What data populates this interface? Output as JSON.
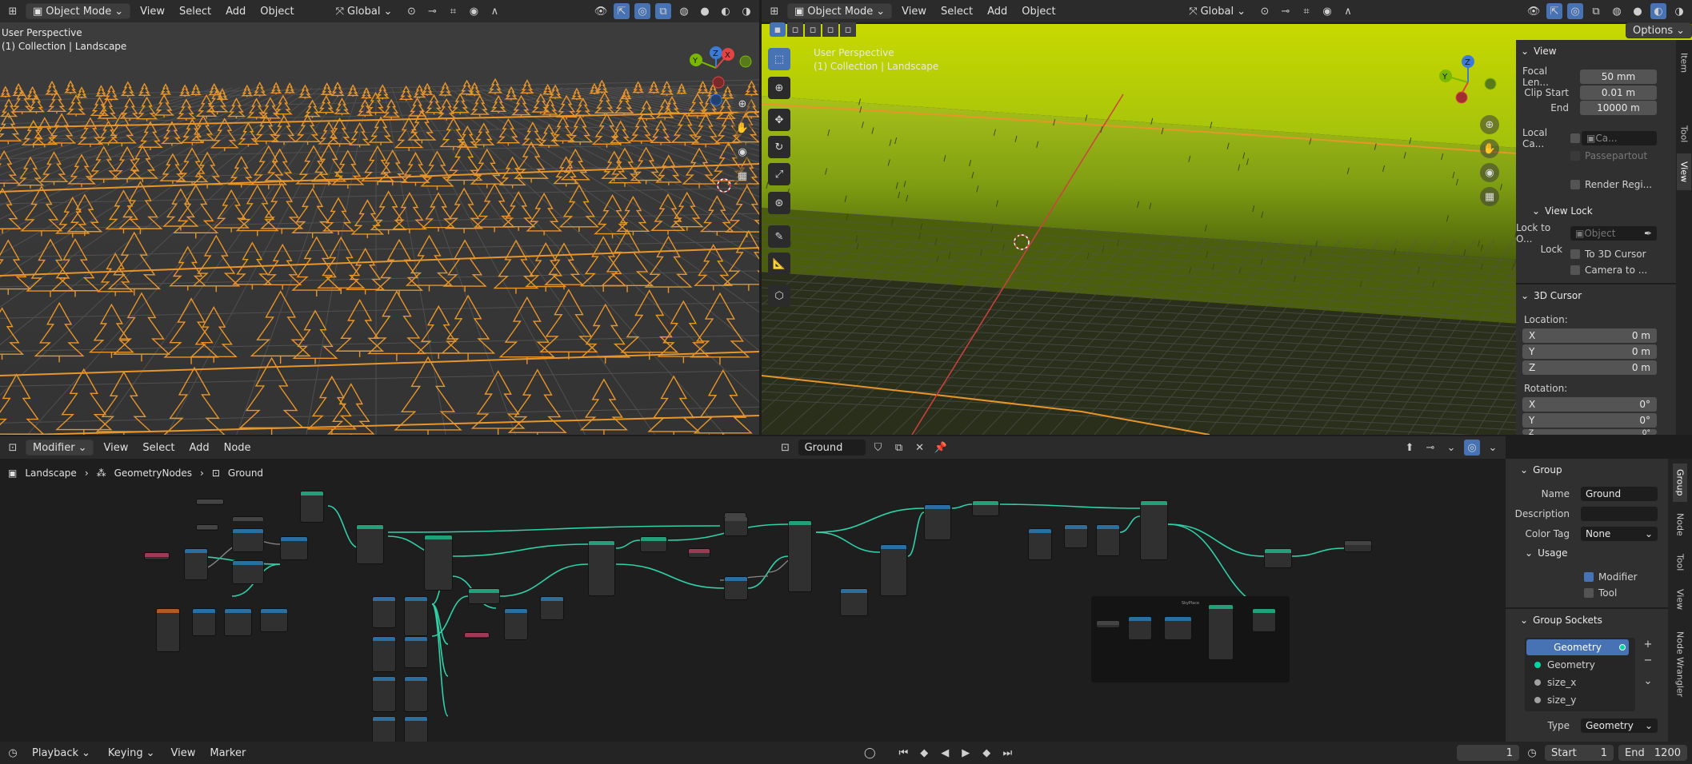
{
  "left_view": {
    "mode": "Object Mode",
    "menu": [
      "View",
      "Select",
      "Add",
      "Object"
    ],
    "orientation": "Global",
    "info_line1": "User Perspective",
    "info_line2": "(1) Collection | Landscape"
  },
  "right_view": {
    "mode": "Object Mode",
    "menu": [
      "View",
      "Select",
      "Add",
      "Object"
    ],
    "orientation": "Global",
    "options": "Options",
    "info_line1": "User Perspective",
    "info_line2": "(1) Collection | Landscape"
  },
  "n_panel": {
    "tabs": [
      "Item",
      "Tool",
      "View"
    ],
    "view_header": "View",
    "focal_label": "Focal Len...",
    "focal_value": "50 mm",
    "clip_start_label": "Clip Start",
    "clip_start_value": "0.01 m",
    "end_label": "End",
    "end_value": "10000 m",
    "local_cam_label": "Local Ca...",
    "local_cam_value": "Ca...",
    "passepartout": "Passepartout",
    "render_region": "Render Regi...",
    "view_lock_header": "View Lock",
    "lock_to_obj_label": "Lock to O...",
    "lock_to_obj_placeholder": "Object",
    "lock_label": "Lock",
    "to_cursor": "To 3D Cursor",
    "camera_to": "Camera to ...",
    "cursor_header": "3D Cursor",
    "location_label": "Location:",
    "loc_x_label": "X",
    "loc_x": "0 m",
    "loc_y_label": "Y",
    "loc_y": "0 m",
    "loc_z_label": "Z",
    "loc_z": "0 m",
    "rotation_label": "Rotation:",
    "rot_x_label": "X",
    "rot_x": "0°",
    "rot_y_label": "Y",
    "rot_y": "0°",
    "rot_z_label": "Z",
    "rot_z": "0°"
  },
  "node_editor": {
    "type": "Modifier",
    "menu": [
      "View",
      "Select",
      "Add",
      "Node"
    ],
    "tree_name": "Ground",
    "breadcrumb": [
      "Landscape",
      "GeometryNodes",
      "Ground"
    ],
    "frame_label": "SkyPlace"
  },
  "group_panel": {
    "tabs": [
      "Group",
      "Node",
      "Tool",
      "View",
      "Node Wrangler"
    ],
    "header": "Group",
    "name_label": "Name",
    "name_value": "Ground",
    "description_label": "Description",
    "description_value": "",
    "color_tag_label": "Color Tag",
    "color_tag_value": "None",
    "usage_header": "Usage",
    "modifier_label": "Modifier",
    "tool_label": "Tool",
    "sockets_header": "Group Sockets",
    "sockets": [
      "Geometry",
      "Geometry",
      "size_x",
      "size_y"
    ],
    "type_label": "Type",
    "type_value": "Geometry"
  },
  "timeline": {
    "menu": [
      "Playback",
      "Keying",
      "View",
      "Marker"
    ],
    "current_frame": "1",
    "start_label": "Start",
    "start_value": "1",
    "end_label": "End",
    "end_value": "1200"
  },
  "colors": {
    "accent": "#4772b3",
    "selection_orange": "#e8952a",
    "node_link": "#2fd1a7",
    "grass": "#8ab000"
  }
}
